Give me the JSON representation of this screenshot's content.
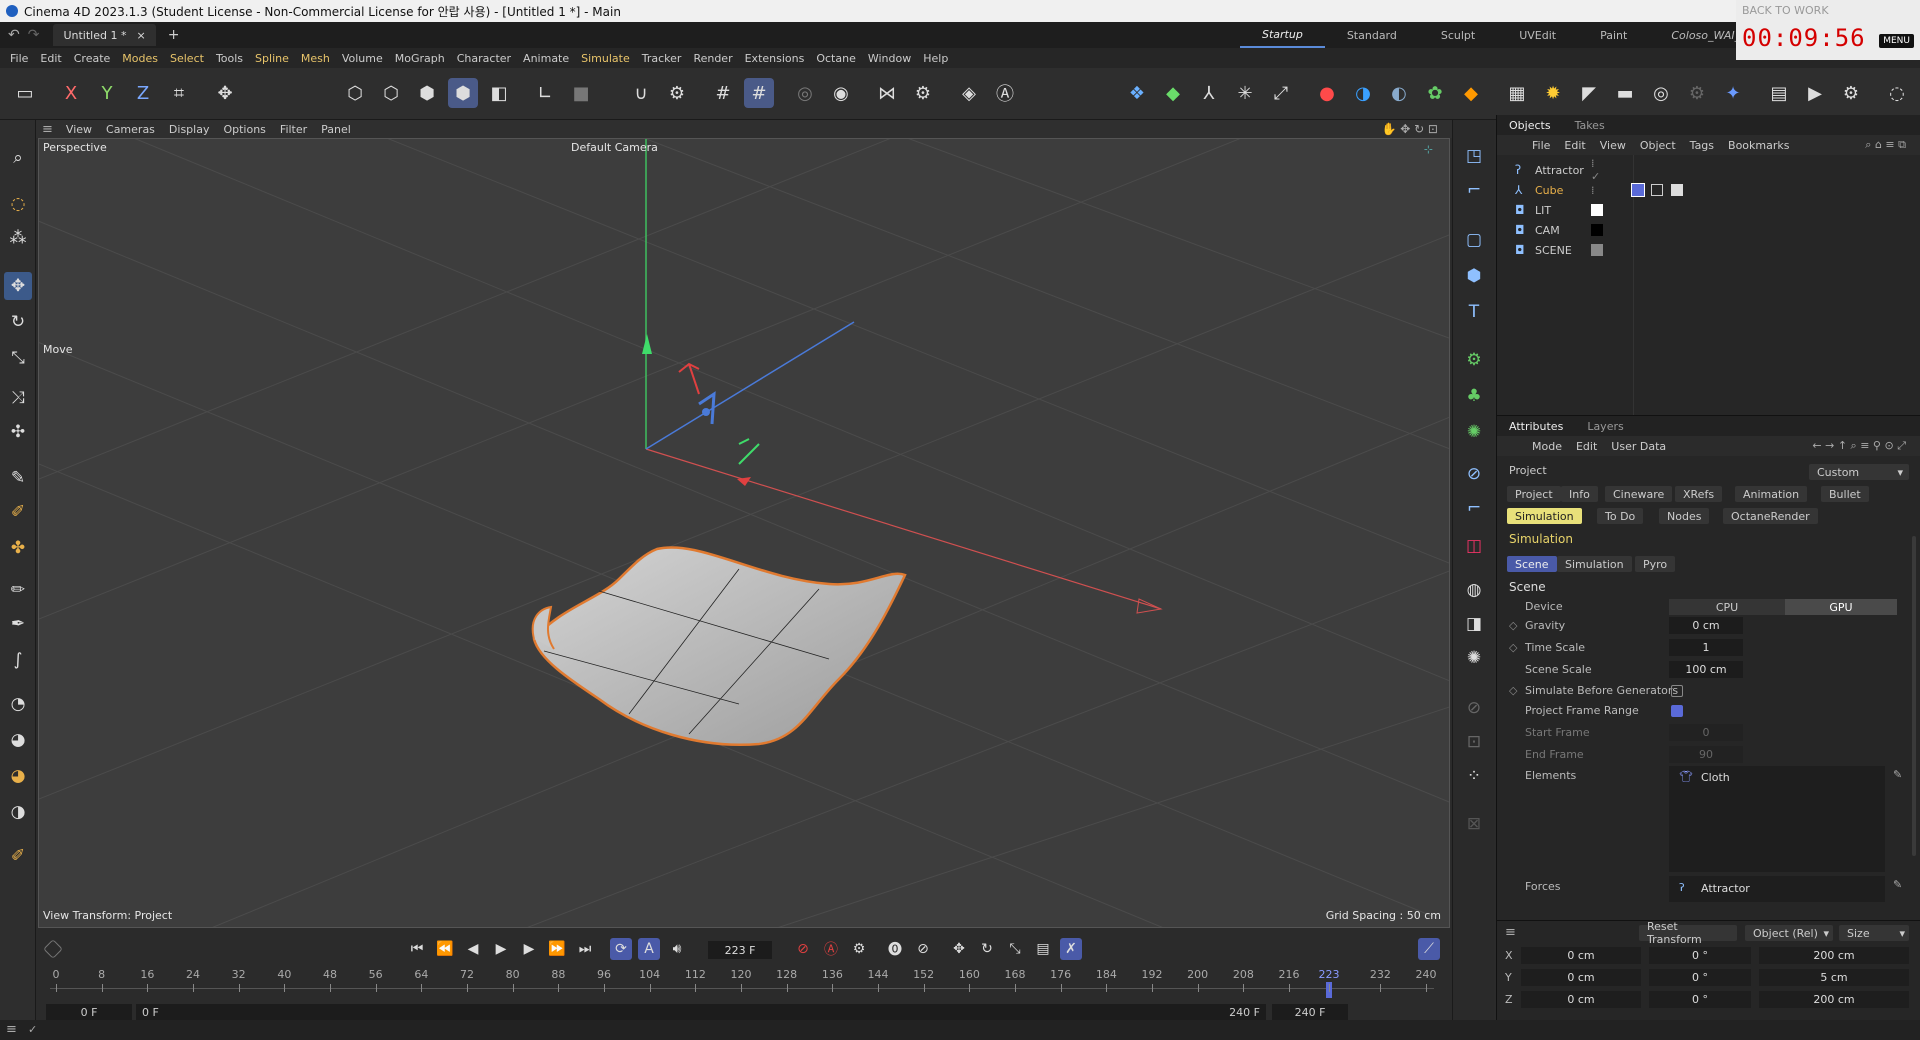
{
  "window": {
    "title": "Cinema 4D 2023.1.3 (Student License - Non-Commercial License for 안랍 사용) - [Untitled 1 *] - Main"
  },
  "tabs": {
    "doc": "Untitled 1 *",
    "close": "×",
    "add": "+"
  },
  "layouts": [
    "Startup",
    "Standard",
    "Sculpt",
    "UVEdit",
    "Paint",
    "Coloso_WAI_Layout"
  ],
  "timer": {
    "back": "BACK TO WORK",
    "clock": "00:09:56",
    "menu": "MENU"
  },
  "menubar": [
    "File",
    "Edit",
    "Create",
    "Modes",
    "Select",
    "Tools",
    "Spline",
    "Mesh",
    "Volume",
    "MoGraph",
    "Character",
    "Animate",
    "Simulate",
    "Tracker",
    "Render",
    "Extensions",
    "Octane",
    "Window",
    "Help"
  ],
  "viewport_menu": [
    "View",
    "Cameras",
    "Display",
    "Options",
    "Filter",
    "Panel"
  ],
  "viewport": {
    "name": "Perspective",
    "camera": "Default Camera",
    "tool": "Move",
    "transform": "View Transform: Project",
    "grid": "Grid Spacing : 50 cm"
  },
  "objects": {
    "tabs": [
      "Objects",
      "Takes"
    ],
    "menu": [
      "File",
      "Edit",
      "View",
      "Object",
      "Tags",
      "Bookmarks"
    ],
    "items": [
      "Attractor",
      "Cube",
      "LIT",
      "CAM",
      "SCENE"
    ]
  },
  "attributes": {
    "tabs": [
      "Attributes",
      "Layers"
    ],
    "menu": [
      "Mode",
      "Edit",
      "User Data"
    ],
    "heading": "Project",
    "preset": "Custom",
    "tabrow1": [
      "Project",
      "Info",
      "Cineware",
      "XRefs",
      "Animation",
      "Bullet"
    ],
    "tabrow2": [
      "Simulation",
      "To Do",
      "Nodes",
      "OctaneRender"
    ],
    "section": "Simulation",
    "subtabs": [
      "Scene",
      "Simulation",
      "Pyro"
    ],
    "group": "Scene",
    "device": {
      "label": "Device",
      "cpu": "CPU",
      "gpu": "GPU"
    },
    "fields": [
      {
        "label": "Gravity",
        "value": "0 cm"
      },
      {
        "label": "Time Scale",
        "value": "1"
      },
      {
        "label": "Scene Scale",
        "value": "100 cm"
      }
    ],
    "simulate_before": "Simulate Before Generators",
    "frame_range": "Project Frame Range",
    "start": {
      "label": "Start Frame",
      "value": "0"
    },
    "end": {
      "label": "End Frame",
      "value": "90"
    },
    "elements": {
      "label": "Elements",
      "item": "Cloth"
    },
    "forces": {
      "label": "Forces",
      "item": "Attractor"
    }
  },
  "coords": {
    "reset": "Reset Transform",
    "mode": "Object (Rel)",
    "size": "Size",
    "rows": [
      {
        "axis": "X",
        "pos": "0 cm",
        "rot": "0 °",
        "size": "200 cm"
      },
      {
        "axis": "Y",
        "pos": "0 cm",
        "rot": "0 °",
        "size": "5 cm"
      },
      {
        "axis": "Z",
        "pos": "0 cm",
        "rot": "0 °",
        "size": "200 cm"
      }
    ]
  },
  "timeline": {
    "frame": "223 F",
    "ticks": [
      "0",
      "8",
      "16",
      "24",
      "32",
      "40",
      "48",
      "56",
      "64",
      "72",
      "80",
      "88",
      "96",
      "104",
      "112",
      "120",
      "128",
      "136",
      "144",
      "152",
      "160",
      "168",
      "176",
      "184",
      "192",
      "200",
      "208",
      "216",
      "223",
      "232",
      "240"
    ],
    "start": "0 F",
    "start2": "0 F",
    "end": "240 F",
    "end2": "240 F",
    "current_fraction": 0.929
  },
  "icons": {
    "toolbar": [
      "undo-icon",
      "redo-icon",
      "null-object-icon"
    ],
    "accent": "#4a5aa8"
  }
}
